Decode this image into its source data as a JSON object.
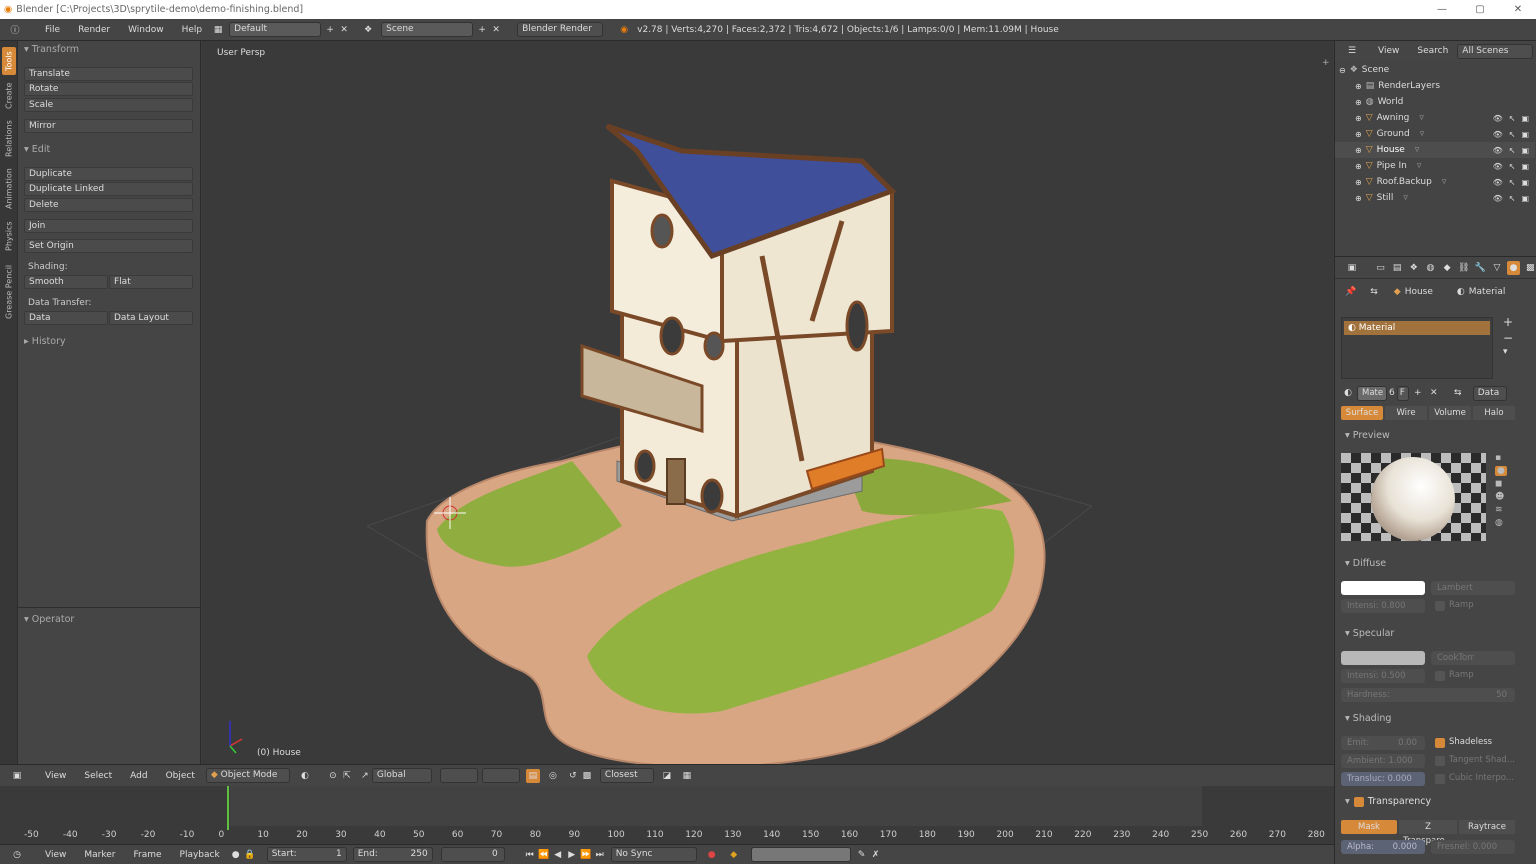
{
  "window": {
    "title": "Blender [C:\\Projects\\3D\\sprytile-demo\\demo-finishing.blend]",
    "min": "—",
    "max": "▢",
    "close": "✕"
  },
  "topbar": {
    "menus": [
      "File",
      "Render",
      "Window",
      "Help"
    ],
    "layout": "Default",
    "scene": "Scene",
    "engine": "Blender Render",
    "stats": "v2.78 | Verts:4,270 | Faces:2,372 | Tris:4,672 | Objects:1/6 | Lamps:0/0 | Mem:11.09M | House"
  },
  "tabs": [
    "Tools",
    "Create",
    "Relations",
    "Animation",
    "Physics",
    "Grease Pencil"
  ],
  "tools": {
    "transform": {
      "title": "Transform",
      "translate": "Translate",
      "rotate": "Rotate",
      "scale": "Scale",
      "mirror": "Mirror"
    },
    "edit": {
      "title": "Edit",
      "duplicate": "Duplicate",
      "duplicate_linked": "Duplicate Linked",
      "delete": "Delete",
      "join": "Join",
      "set_origin": "Set Origin",
      "shading": "Shading:",
      "smooth": "Smooth",
      "flat": "Flat",
      "data_transfer": "Data Transfer:",
      "data": "Data",
      "data_layout": "Data Layout"
    },
    "history": "History",
    "operator": "Operator"
  },
  "viewport": {
    "title": "User Persp",
    "object": "(0) House"
  },
  "view_header": {
    "menus": [
      "View",
      "Select",
      "Add",
      "Object"
    ],
    "mode": "Object Mode",
    "orientation": "Global",
    "snap": "Closest"
  },
  "timeline": {
    "ticks": [
      "-50",
      "-40",
      "-30",
      "-20",
      "-10",
      "0",
      "10",
      "20",
      "30",
      "40",
      "50",
      "60",
      "70",
      "80",
      "90",
      "100",
      "110",
      "120",
      "130",
      "140",
      "150",
      "160",
      "170",
      "180",
      "190",
      "200",
      "210",
      "220",
      "230",
      "240",
      "250",
      "260",
      "270",
      "280"
    ]
  },
  "tl_header": {
    "menus": [
      "View",
      "Marker",
      "Frame",
      "Playback"
    ],
    "start_label": "Start:",
    "start": "1",
    "end_label": "End:",
    "end": "250",
    "current": "0",
    "sync": "No Sync"
  },
  "outliner": {
    "menus": [
      "View",
      "Search",
      "All Scenes"
    ],
    "items": [
      {
        "label": "Scene",
        "indent": 0
      },
      {
        "label": "RenderLayers",
        "indent": 1
      },
      {
        "label": "World",
        "indent": 1
      },
      {
        "label": "Awning",
        "indent": 1
      },
      {
        "label": "Ground",
        "indent": 1
      },
      {
        "label": "House",
        "indent": 1
      },
      {
        "label": "Pipe In",
        "indent": 1
      },
      {
        "label": "Roof.Backup",
        "indent": 1
      },
      {
        "label": "Still",
        "indent": 1
      }
    ]
  },
  "props": {
    "context_object": "House",
    "context_material": "Material",
    "slot": "Material",
    "mat_name": "Mate",
    "mat_users": "6",
    "mat_f": "F",
    "data": "Data",
    "tabs": [
      "Surface",
      "Wire",
      "Volume",
      "Halo"
    ],
    "preview": "Preview",
    "diffuse": {
      "title": "Diffuse",
      "shader": "Lambert",
      "intensity": "Intensi: 0.800",
      "ramp": "Ramp"
    },
    "specular": {
      "title": "Specular",
      "shader": "CookTorr",
      "intensity": "Intensi: 0.500",
      "ramp": "Ramp",
      "hardness": "Hardness:",
      "hardness_val": "50"
    },
    "shading": {
      "title": "Shading",
      "emit": "Emit:",
      "emit_val": "0.00",
      "shadeless": "Shadeless",
      "ambient": "Ambient: 1.000",
      "tangent": "Tangent Shad...",
      "transluc": "Transluc: 0.000",
      "cubic": "Cubic Interpo..."
    },
    "transparency": {
      "title": "Transparency",
      "mask": "Mask",
      "ztransp": "Z Transpare...",
      "raytrace": "Raytrace",
      "alpha": "Alpha:",
      "alpha_val": "0.000",
      "fresnel": "Fresnel: 0.000"
    }
  }
}
